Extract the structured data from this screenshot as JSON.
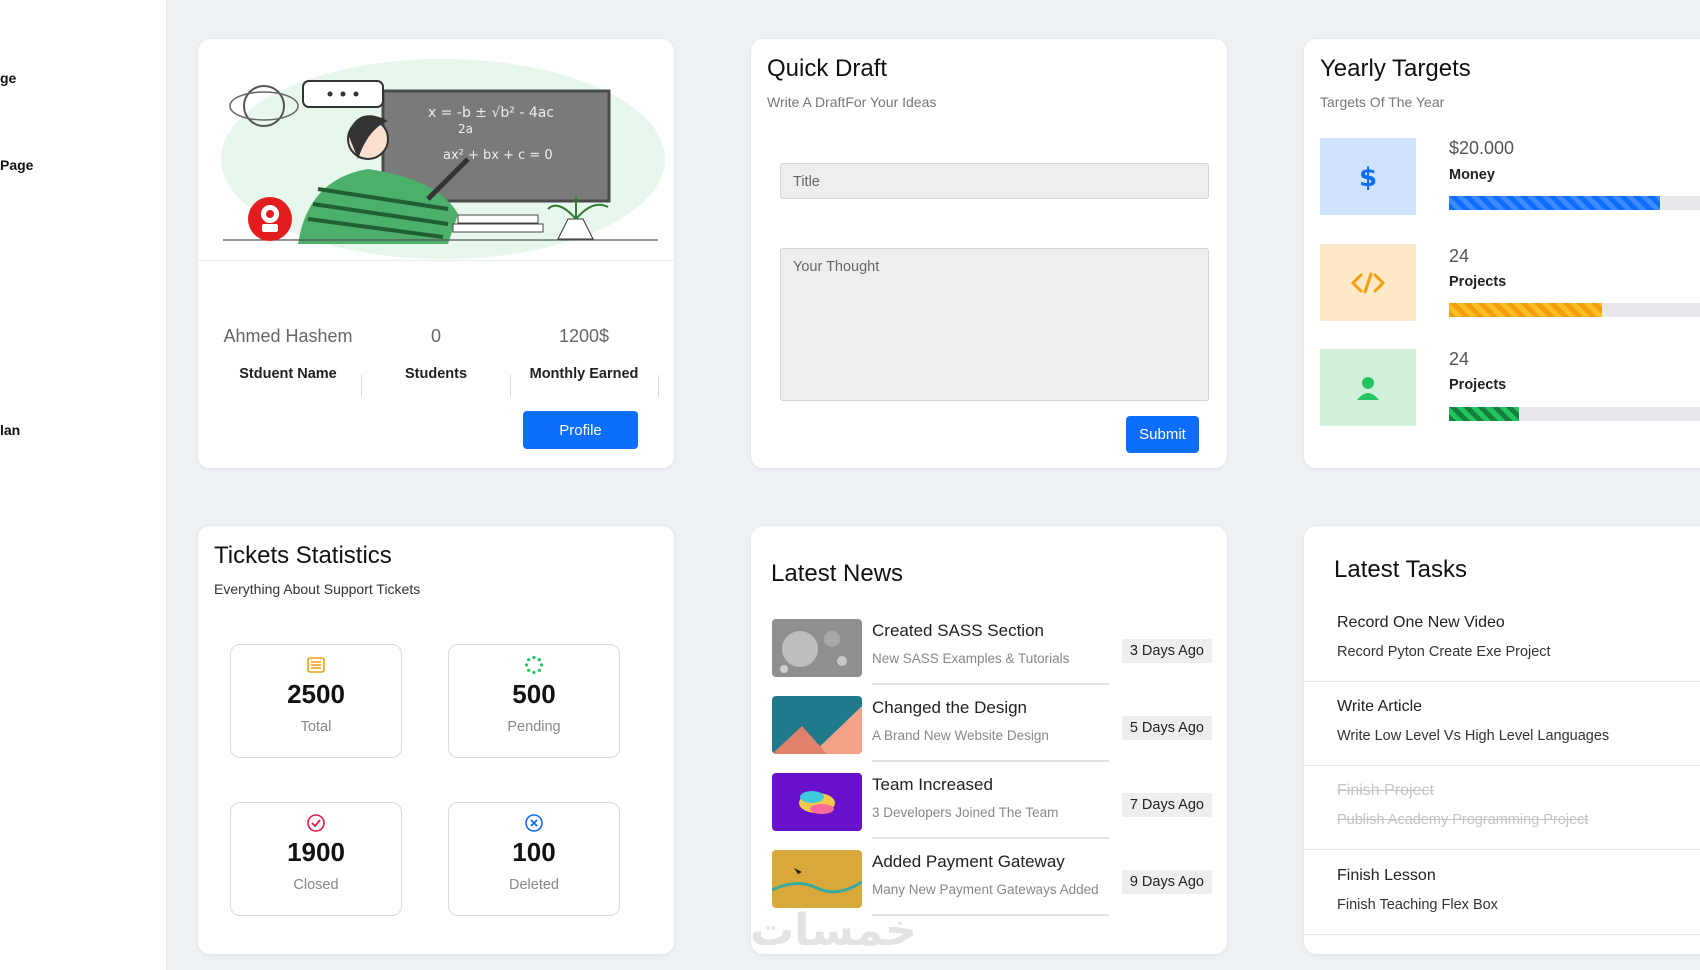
{
  "sidebar": {
    "items": [
      {
        "label": "ge"
      },
      {
        "label": "Page"
      },
      {
        "label": "lan"
      }
    ]
  },
  "welcome": {
    "stats": [
      {
        "value": "Ahmed Hashem",
        "label": "Stduent Name"
      },
      {
        "value": "0",
        "label": "Students"
      },
      {
        "value": "1200$",
        "label": "Monthly Earned"
      }
    ],
    "profile_button": "Profile"
  },
  "draft": {
    "title": "Quick Draft",
    "subtitle": "Write A DraftFor Your Ideas",
    "title_placeholder": "Title",
    "thought_placeholder": "Your Thought",
    "submit_button": "Submit"
  },
  "targets": {
    "title": "Yearly Targets",
    "subtitle": "Targets Of The Year",
    "items": [
      {
        "value": "$20.000",
        "label": "Money",
        "icon": "dollar-icon",
        "progress": 0.81,
        "color": "#0d6efd",
        "bg": "#cfe2ff"
      },
      {
        "value": "24",
        "label": "Projects",
        "icon": "code-icon",
        "progress": 0.59,
        "color": "#f59e0b",
        "bg": "#fde9c8"
      },
      {
        "value": "24",
        "label": "Projects",
        "icon": "user-icon",
        "progress": 0.27,
        "color": "#22c55e",
        "bg": "#d1f0da"
      }
    ]
  },
  "tickets": {
    "title": "Tickets Statistics",
    "subtitle": "Everything About Support Tickets",
    "boxes": [
      {
        "value": "2500",
        "label": "Total",
        "icon": "list-icon",
        "color": "#f59e0b"
      },
      {
        "value": "500",
        "label": "Pending",
        "icon": "spinner-icon",
        "color": "#22c55e"
      },
      {
        "value": "1900",
        "label": "Closed",
        "icon": "check-circle-icon",
        "color": "#e11d48"
      },
      {
        "value": "100",
        "label": "Deleted",
        "icon": "x-circle-icon",
        "color": "#0d6efd"
      }
    ]
  },
  "news": {
    "title": "Latest News",
    "items": [
      {
        "title": "Created SASS Section",
        "desc": "New SASS Examples & Tutorials",
        "date": "3 Days Ago"
      },
      {
        "title": "Changed the Design",
        "desc": "A Brand New Website Design",
        "date": "5 Days Ago"
      },
      {
        "title": "Team Increased",
        "desc": "3 Developers Joined The Team",
        "date": "7 Days Ago"
      },
      {
        "title": "Added Payment Gateway",
        "desc": "Many New Payment Gateways Added",
        "date": "9 Days Ago"
      }
    ]
  },
  "tasks": {
    "title": "Latest Tasks",
    "items": [
      {
        "title": "Record One New Video",
        "desc": "Record Pyton Create Exe Project",
        "done": false
      },
      {
        "title": "Write Article",
        "desc": "Write Low Level Vs High Level Languages",
        "done": false
      },
      {
        "title": "Finish Project",
        "desc": "Publish Academy Programming Project",
        "done": true
      },
      {
        "title": "Finish Lesson",
        "desc": "Finish Teaching Flex Box",
        "done": false
      }
    ]
  },
  "watermark": "خمسات"
}
